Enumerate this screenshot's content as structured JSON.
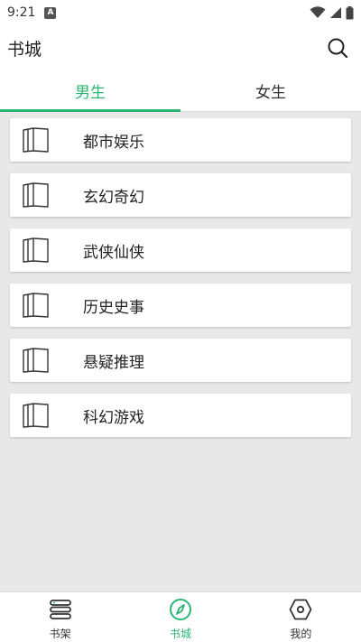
{
  "status_bar": {
    "time": "9:21",
    "notification_badge": "A"
  },
  "app_bar": {
    "title": "书城"
  },
  "tabs": [
    {
      "label": "男生",
      "active": true
    },
    {
      "label": "女生",
      "active": false
    }
  ],
  "categories": [
    {
      "label": "都市娱乐",
      "icon": "book-icon"
    },
    {
      "label": "玄幻奇幻",
      "icon": "book-icon"
    },
    {
      "label": "武侠仙侠",
      "icon": "book-icon"
    },
    {
      "label": "历史史事",
      "icon": "book-icon"
    },
    {
      "label": "悬疑推理",
      "icon": "book-icon"
    },
    {
      "label": "科幻游戏",
      "icon": "book-icon"
    }
  ],
  "bottom_nav": [
    {
      "label": "书架",
      "icon": "bookshelf-icon",
      "active": false
    },
    {
      "label": "书城",
      "icon": "compass-icon",
      "active": true
    },
    {
      "label": "我的",
      "icon": "profile-hexagon-icon",
      "active": false
    }
  ],
  "colors": {
    "accent": "#2bb673",
    "background": "#e8e8e8",
    "surface": "#ffffff"
  }
}
